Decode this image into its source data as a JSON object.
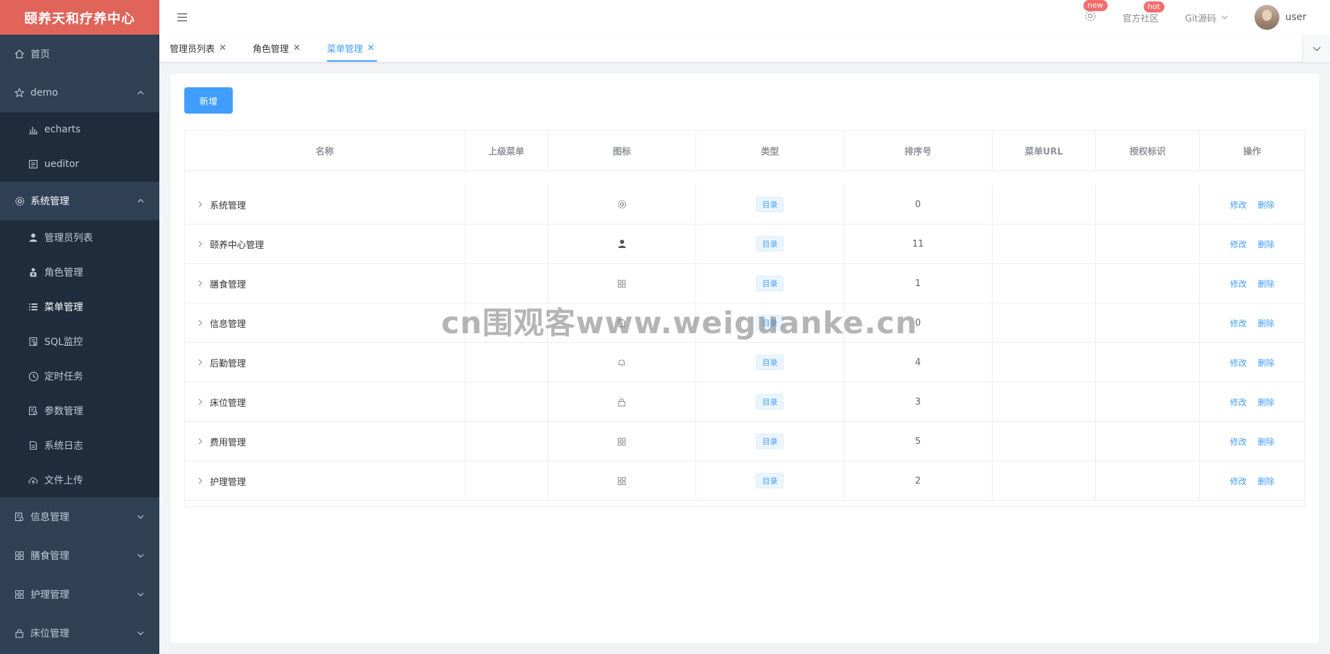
{
  "app": {
    "title": "颐养天和疗养中心"
  },
  "sidebar": {
    "items": [
      {
        "label": "首页",
        "icon": "home-icon"
      },
      {
        "label": "demo",
        "icon": "star-icon",
        "open": true,
        "children": [
          {
            "label": "echarts",
            "icon": "bar-chart-icon"
          },
          {
            "label": "ueditor",
            "icon": "editor-icon"
          }
        ]
      },
      {
        "label": "系统管理",
        "icon": "gear-icon",
        "open": true,
        "children": [
          {
            "label": "管理员列表",
            "icon": "user-icon"
          },
          {
            "label": "角色管理",
            "icon": "role-icon"
          },
          {
            "label": "菜单管理",
            "icon": "list-icon",
            "active": true
          },
          {
            "label": "SQL监控",
            "icon": "monitor-icon"
          },
          {
            "label": "定时任务",
            "icon": "clock-icon"
          },
          {
            "label": "参数管理",
            "icon": "params-icon"
          },
          {
            "label": "系统日志",
            "icon": "log-icon"
          },
          {
            "label": "文件上传",
            "icon": "upload-icon"
          }
        ]
      },
      {
        "label": "信息管理",
        "icon": "info-icon"
      },
      {
        "label": "膳食管理",
        "icon": "grid-icon"
      },
      {
        "label": "护理管理",
        "icon": "grid-icon"
      },
      {
        "label": "床位管理",
        "icon": "lock-icon"
      }
    ]
  },
  "navbar": {
    "new_badge": "new",
    "community": "官方社区",
    "hot_badge": "hot",
    "git": "Git源码",
    "user": "user"
  },
  "tabs": [
    {
      "label": "管理员列表",
      "active": false
    },
    {
      "label": "角色管理",
      "active": false
    },
    {
      "label": "菜单管理",
      "active": true
    }
  ],
  "toolbar": {
    "add_label": "新增"
  },
  "table": {
    "headers": [
      "名称",
      "上级菜单",
      "图标",
      "类型",
      "排序号",
      "菜单URL",
      "授权标识",
      "操作"
    ],
    "rows": [
      {
        "name": "系统管理",
        "icon": "gear-icon",
        "type": "目录",
        "order": "0"
      },
      {
        "name": "颐养中心管理",
        "icon": "user-icon",
        "type": "目录",
        "order": "11"
      },
      {
        "name": "膳食管理",
        "icon": "grid-icon",
        "type": "目录",
        "order": "1"
      },
      {
        "name": "信息管理",
        "icon": "doc-icon",
        "type": "目录",
        "order": "0"
      },
      {
        "name": "后勤管理",
        "icon": "bell-icon",
        "type": "目录",
        "order": "4"
      },
      {
        "name": "床位管理",
        "icon": "lock-icon",
        "type": "目录",
        "order": "3"
      },
      {
        "name": "费用管理",
        "icon": "grid-icon",
        "type": "目录",
        "order": "5"
      },
      {
        "name": "护理管理",
        "icon": "grid-icon",
        "type": "目录",
        "order": "2"
      }
    ],
    "edit_label": "修改",
    "delete_label": "删除"
  },
  "watermark": "cn围观客www.weiguanke.cn",
  "colors": {
    "primary": "#409eff",
    "sidebar": "#304156",
    "logo": "#e06459",
    "badge": "#f56c6c"
  }
}
